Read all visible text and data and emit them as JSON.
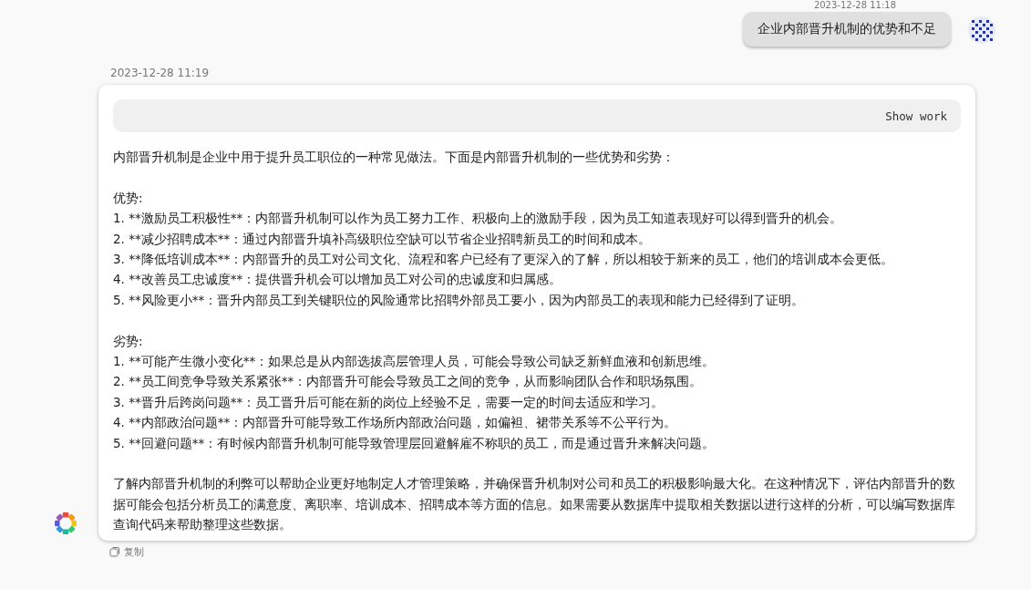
{
  "user_message": {
    "time": "2023-12-28 11:18",
    "text": "企业内部晋升机制的优势和不足"
  },
  "reply": {
    "time": "2023-12-28 11:19",
    "show_work": "Show work",
    "intro": "内部晋升机制是企业中用于提升员工职位的一种常见做法。下面是内部晋升机制的一些优势和劣势：",
    "sections": [
      {
        "heading": "优势:",
        "items": [
          "1. **激励员工积极性**：内部晋升机制可以作为员工努力工作、积极向上的激励手段，因为员工知道表现好可以得到晋升的机会。",
          "2. **减少招聘成本**：通过内部晋升填补高级职位空缺可以节省企业招聘新员工的时间和成本。",
          "3. **降低培训成本**：内部晋升的员工对公司文化、流程和客户已经有了更深入的了解，所以相较于新来的员工，他们的培训成本会更低。",
          "4. **改善员工忠诚度**：提供晋升机会可以增加员工对公司的忠诚度和归属感。",
          "5. **风险更小**：晋升内部员工到关键职位的风险通常比招聘外部员工要小，因为内部员工的表现和能力已经得到了证明。"
        ]
      },
      {
        "heading": "劣势:",
        "items": [
          "1. **可能产生微小变化**：如果总是从内部选拔高层管理人员，可能会导致公司缺乏新鲜血液和创新思维。",
          "2. **员工间竞争导致关系紧张**：内部晋升可能会导致员工之间的竞争，从而影响团队合作和职场氛围。",
          "3. **晋升后跨岗问题**：员工晋升后可能在新的岗位上经验不足，需要一定的时间去适应和学习。",
          "4. **内部政治问题**：内部晋升可能导致工作场所内部政治问题，如偏袒、裙带关系等不公平行为。",
          "5. **回避问题**：有时候内部晋升机制可能导致管理层回避解雇不称职的员工，而是通过晋升来解决问题。"
        ]
      }
    ],
    "conclusion": "了解内部晋升机制的利弊可以帮助企业更好地制定人才管理策略，并确保晋升机制对公司和员工的积极影响最大化。在这种情况下，评估内部晋升的数据可能会包括分析员工的满意度、离职率、培训成本、招聘成本等方面的信息。如果需要从数据库中提取相关数据以进行这样的分析，可以编写数据库查询代码来帮助整理这些数据。"
  },
  "copy_label": "复制"
}
